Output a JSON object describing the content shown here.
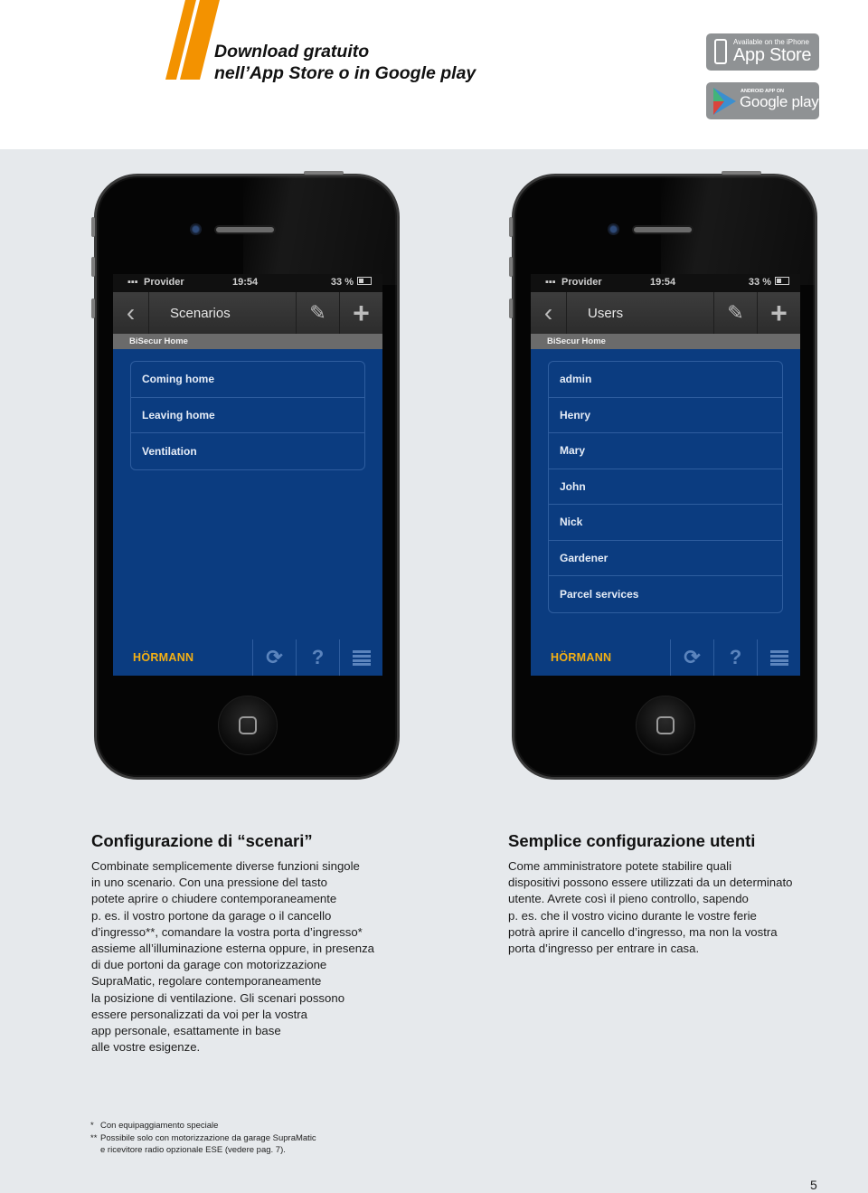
{
  "header": {
    "headline_line1": "Download gratuito",
    "headline_line2": "nell’App Store o in Google play",
    "accent_color": "#f39200",
    "badges": {
      "appstore": {
        "small": "Available on the iPhone",
        "large": "App Store",
        "icon": "iphone-icon"
      },
      "googleplay": {
        "small": "ANDROID APP ON",
        "large": "Google play",
        "icon": "google-play-icon"
      }
    }
  },
  "phones": [
    {
      "status": {
        "carrier": "Provider",
        "time": "19:54",
        "battery": "33 %"
      },
      "nav": {
        "back": "‹",
        "title": "Scenarios",
        "edit_icon": "✎",
        "add_icon": "+"
      },
      "subtitle": "BiSecur Home",
      "items": [
        "Coming home",
        "Leaving home",
        "Ventilation"
      ],
      "bottom": {
        "brand": "HÖRMANN",
        "refresh_icon": "⟳",
        "help_icon": "?"
      }
    },
    {
      "status": {
        "carrier": "Provider",
        "time": "19:54",
        "battery": "33 %"
      },
      "nav": {
        "back": "‹",
        "title": "Users",
        "edit_icon": "✎",
        "add_icon": "+"
      },
      "subtitle": "BiSecur Home",
      "items": [
        "admin",
        "Henry",
        "Mary",
        "John",
        "Nick",
        "Gardener",
        "Parcel services"
      ],
      "bottom": {
        "brand": "HÖRMANN",
        "refresh_icon": "⟳",
        "help_icon": "?"
      }
    }
  ],
  "sections": {
    "scenarios": {
      "title": "Configurazione di “scenari”",
      "body": "Combinate semplicemente diverse funzioni singole\nin uno scenario. Con una pressione del tasto\npotete aprire o chiudere contemporaneamente\np. es. il vostro portone da garage o il cancello\nd’ingresso**, comandare la vostra porta d’ingresso*\nassieme all’illuminazione esterna oppure, in presenza\ndi due portoni da garage con motorizzazione\nSupraMatic, regolare contemporaneamente\nla posizione di ventilazione. Gli scenari possono\nessere personalizzati da voi per la vostra\napp personale, esattamente in base\nalle vostre esigenze."
    },
    "users": {
      "title": "Semplice configurazione utenti",
      "body": "Come amministratore potete stabilire quali\ndispositivi possono essere utilizzati da un determinato\nutente. Avrete così il pieno controllo, sapendo\np. es. che il vostro vicino durante le vostre ferie\npotrà  aprire il cancello d’ingresso, ma non la vostra\nporta d’ingresso per entrare in casa."
    }
  },
  "footnotes": [
    {
      "mark": "*",
      "text": "Con equipaggiamento speciale"
    },
    {
      "mark": "**",
      "text": "Possibile solo con motorizzazione da garage SupraMatic"
    },
    {
      "mark": "",
      "text": "e ricevitore radio opzionale ESE (vedere pag. 7)."
    }
  ],
  "page_number": "5"
}
